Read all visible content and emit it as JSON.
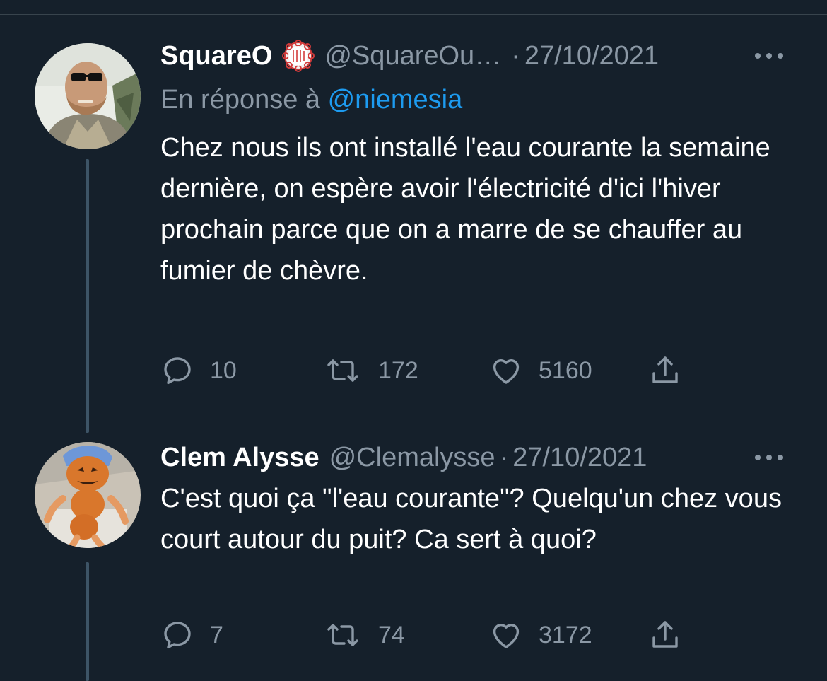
{
  "tweets": [
    {
      "author_name": "SquareO",
      "verified_badge_icon": "seal-stamp-icon",
      "handle": "@SquareOu…",
      "separator": "·",
      "date": "27/10/2021",
      "reply_prefix": "En réponse à ",
      "reply_mention": "@niemesia",
      "text": "Chez nous ils ont installé l'eau courante la semaine dernière, on espère avoir l'électricité d'ici l'hiver prochain parce que on a marre de se chauffer au fumier de chèvre.",
      "replies": "10",
      "retweets": "172",
      "likes": "5160"
    },
    {
      "author_name": "Clem Alysse",
      "handle": "@Clemalysse",
      "separator": "·",
      "date": "27/10/2021",
      "text": "C'est quoi ça \"l'eau courante\"? Quelqu'un chez vous court autour du puit? Ca sert à quoi?",
      "replies": "7",
      "retweets": "74",
      "likes": "3172"
    }
  ],
  "colors": {
    "background": "#15202b",
    "secondary_text": "#8b98a5",
    "link": "#1d9bf0",
    "thread_line": "#3d5466"
  }
}
